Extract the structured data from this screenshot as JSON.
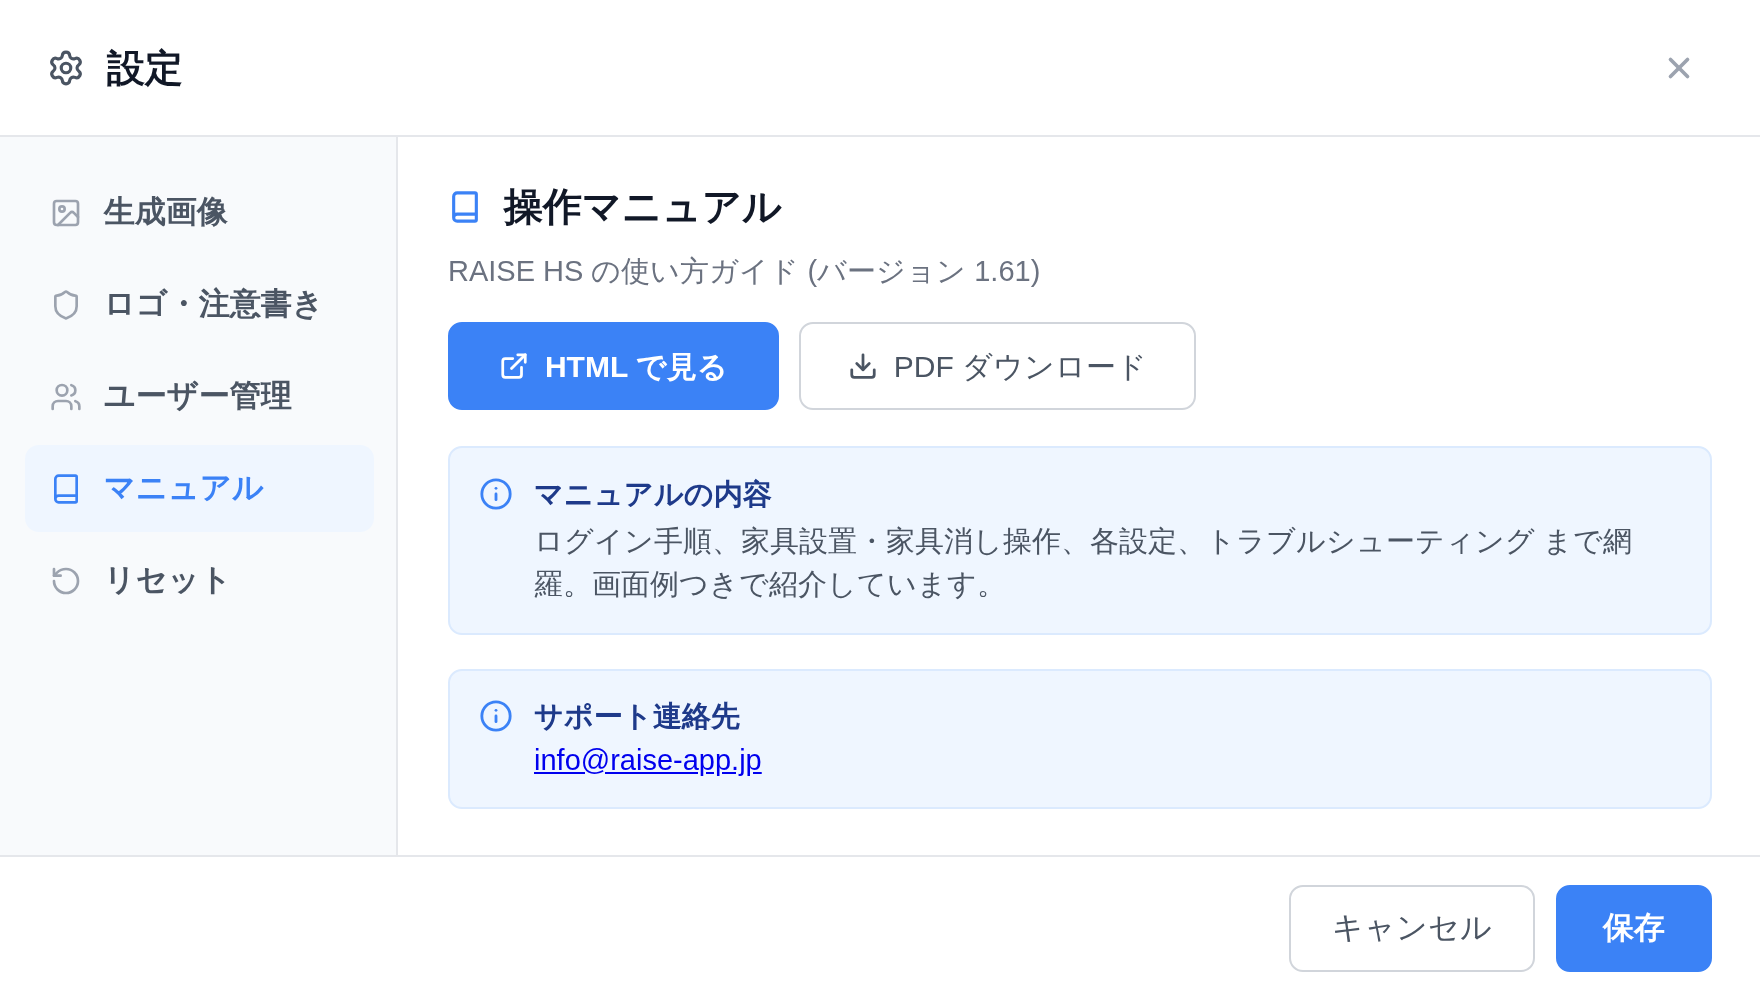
{
  "dialog": {
    "title": "設定"
  },
  "sidebar": {
    "items": [
      {
        "label": "生成画像",
        "selected": false
      },
      {
        "label": "ロゴ・注意書き",
        "selected": false
      },
      {
        "label": "ユーザー管理",
        "selected": false
      },
      {
        "label": "マニュアル",
        "selected": true
      },
      {
        "label": "リセット",
        "selected": false
      }
    ]
  },
  "content": {
    "title": "操作マニュアル",
    "subtitle": "RAISE HS の使い方ガイド (バージョン 1.61)",
    "buttons": [
      {
        "label": "HTML で見る",
        "kind": "primary"
      },
      {
        "label": "PDF ダウンロード",
        "kind": "secondary"
      }
    ],
    "notices": [
      {
        "title": "マニュアルの内容",
        "text": "ログイン手順、家具設置・家具消し操作、各設定、トラブルシューティング まで網羅。画面例つきで紹介しています。"
      },
      {
        "title": "サポート連絡先",
        "link": "info@raise-app.jp"
      }
    ]
  },
  "footer": {
    "buttons": [
      {
        "label": "キャンセル",
        "kind": "secondary"
      },
      {
        "label": "保存",
        "kind": "primary"
      }
    ]
  }
}
